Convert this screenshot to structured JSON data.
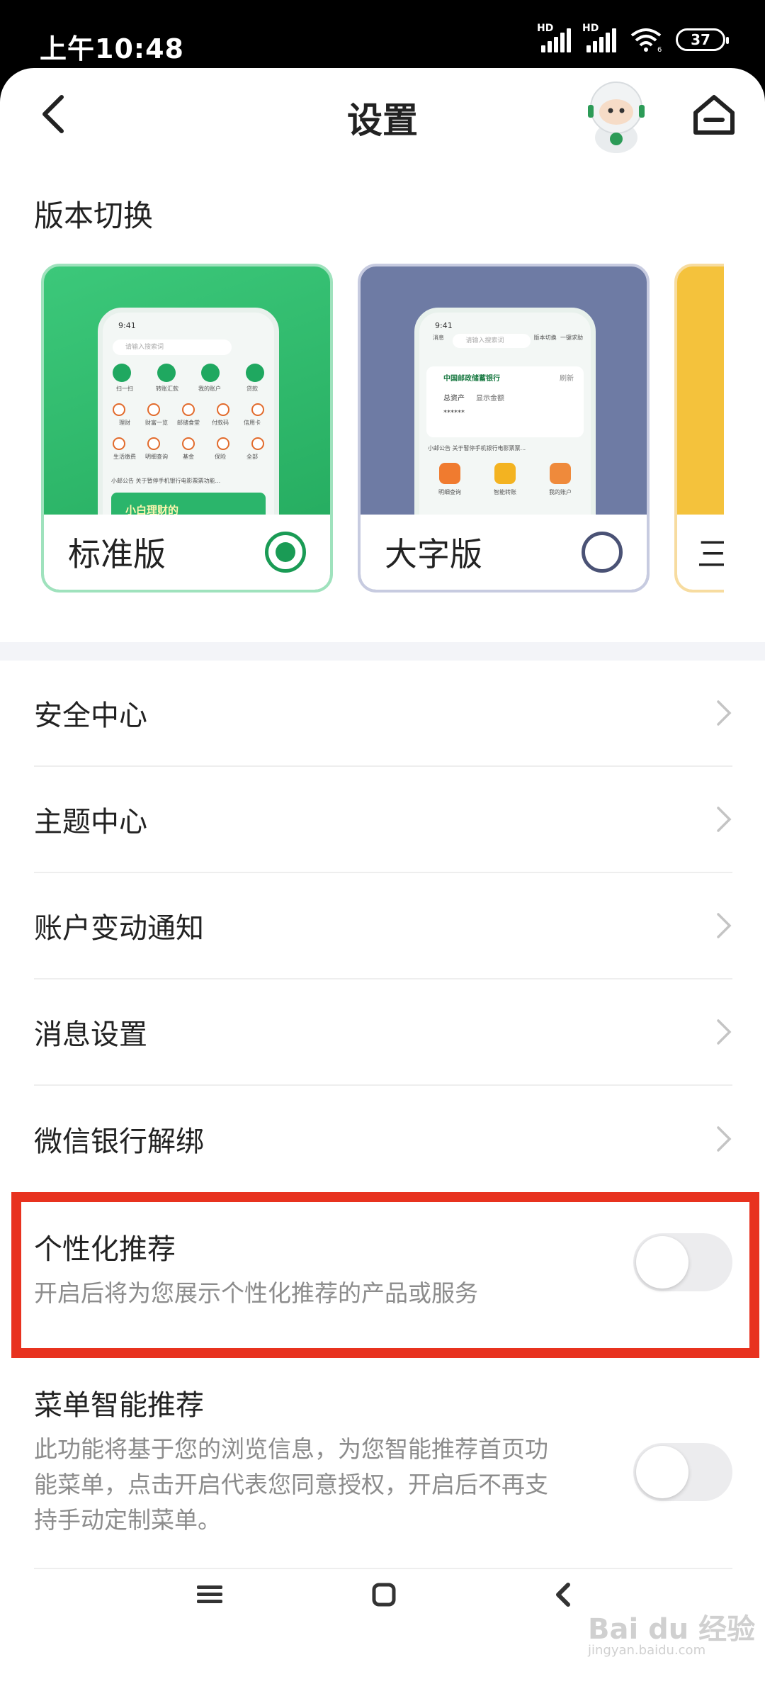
{
  "status_bar": {
    "time": "上午10:48",
    "signal1_tag": "HD",
    "signal2_tag": "HD",
    "wifi_tag": "6",
    "battery": "37"
  },
  "header": {
    "title": "设置"
  },
  "version_switch": {
    "title": "版本切换",
    "options": [
      {
        "label": "标准版",
        "selected": true
      },
      {
        "label": "大字版",
        "selected": false
      },
      {
        "label": "三",
        "selected": false
      }
    ],
    "preview_standard": {
      "time": "9:41",
      "search_placeholder": "请输入搜索词",
      "quick": [
        "扫一扫",
        "转账汇款",
        "我的账户",
        "贷款"
      ],
      "row1": [
        "理财",
        "财富一览",
        "邮储食堂",
        "付款码",
        "信用卡"
      ],
      "row2": [
        "生活缴费",
        "明细查询",
        "基金",
        "保险",
        "全部"
      ],
      "notice": "小邮公告 关于暂停手机银行电影票票功能...",
      "banner": "小白理财的"
    },
    "preview_large": {
      "time": "9:41",
      "top_icons": [
        "消息",
        "版本切换",
        "一键求助"
      ],
      "search_placeholder": "请输入搜索词",
      "bank_name": "中国邮政储蓄银行",
      "refresh": "刷新",
      "total_assets": "总资产",
      "show_amount": "显示金额",
      "masked": "******",
      "notice": "小邮公告 关于暂停手机银行电影票票...",
      "functions": [
        "明细查询",
        "智能转账",
        "我的账户"
      ]
    }
  },
  "menu": [
    {
      "label": "安全中心"
    },
    {
      "label": "主题中心"
    },
    {
      "label": "账户变动通知"
    },
    {
      "label": "消息设置"
    },
    {
      "label": "微信银行解绑"
    }
  ],
  "toggles": [
    {
      "label": "个性化推荐",
      "description": "开启后将为您展示个性化推荐的产品或服务",
      "enabled": false
    },
    {
      "label": "菜单智能推荐",
      "description_lines": [
        "此功能将基于您的浏览信息，为您智能推荐首页功",
        "能菜单，点击开启代表您同意授权，开启后不再支",
        "持手动定制菜单。"
      ],
      "enabled": false
    }
  ],
  "watermark": {
    "brand": "Bai du 经验",
    "url": "jingyan.baidu.com"
  },
  "colors": {
    "accent_green": "#1a9b55",
    "highlight_red": "#e8321f",
    "large_version_bg": "#6e7ba4"
  }
}
